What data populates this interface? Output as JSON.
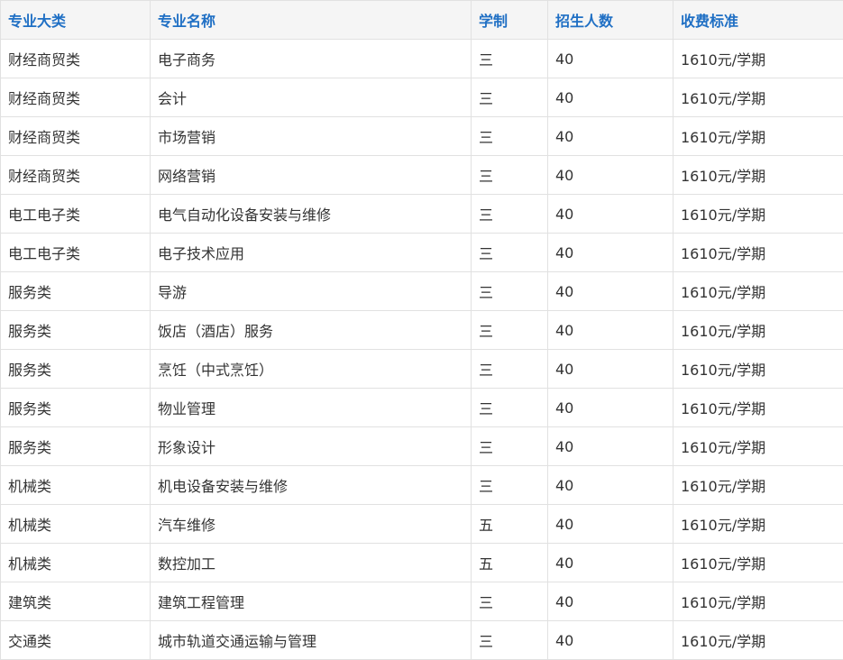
{
  "colors": {
    "header_text": "#1f6fc4",
    "header_bg": "#f5f5f5",
    "body_text": "#333333",
    "border": "#e1e1e1"
  },
  "table": {
    "headers": [
      "专业大类",
      "专业名称",
      "学制",
      "招生人数",
      "收费标准"
    ],
    "rows": [
      [
        "财经商贸类",
        "电子商务",
        "三",
        "40",
        "1610元/学期"
      ],
      [
        "财经商贸类",
        "会计",
        "三",
        "40",
        "1610元/学期"
      ],
      [
        "财经商贸类",
        "市场营销",
        "三",
        "40",
        "1610元/学期"
      ],
      [
        "财经商贸类",
        "网络营销",
        "三",
        "40",
        "1610元/学期"
      ],
      [
        "电工电子类",
        "电气自动化设备安装与维修",
        "三",
        "40",
        "1610元/学期"
      ],
      [
        "电工电子类",
        "电子技术应用",
        "三",
        "40",
        "1610元/学期"
      ],
      [
        "服务类",
        "导游",
        "三",
        "40",
        "1610元/学期"
      ],
      [
        "服务类",
        "饭店（酒店）服务",
        "三",
        "40",
        "1610元/学期"
      ],
      [
        "服务类",
        "烹饪（中式烹饪）",
        "三",
        "40",
        "1610元/学期"
      ],
      [
        "服务类",
        "物业管理",
        "三",
        "40",
        "1610元/学期"
      ],
      [
        "服务类",
        "形象设计",
        "三",
        "40",
        "1610元/学期"
      ],
      [
        "机械类",
        "机电设备安装与维修",
        "三",
        "40",
        "1610元/学期"
      ],
      [
        "机械类",
        "汽车维修",
        "五",
        "40",
        "1610元/学期"
      ],
      [
        "机械类",
        "数控加工",
        "五",
        "40",
        "1610元/学期"
      ],
      [
        "建筑类",
        "建筑工程管理",
        "三",
        "40",
        "1610元/学期"
      ],
      [
        "交通类",
        "城市轨道交通运输与管理",
        "三",
        "40",
        "1610元/学期"
      ]
    ]
  }
}
